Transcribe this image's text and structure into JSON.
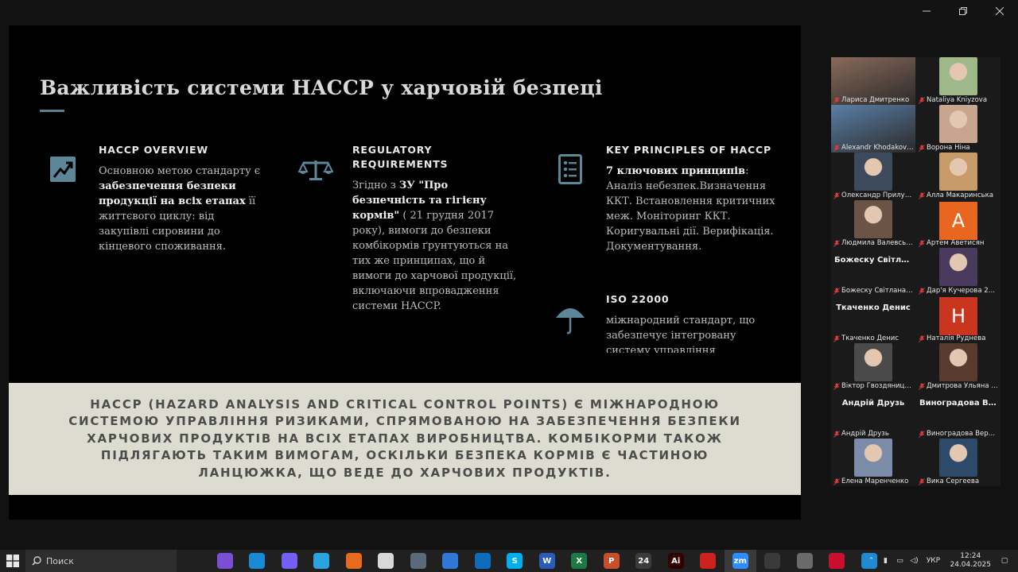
{
  "window": {
    "minimize_label": "",
    "maximize_label": "",
    "close_label": ""
  },
  "slide": {
    "title": "Важливість системи HACCP у харчовій безпеці",
    "columns": [
      {
        "heading": "HACCP OVERVIEW",
        "text_parts": [
          {
            "t": "Основною метою стандарту є ",
            "b": false
          },
          {
            "t": "забезпечення безпеки продукції на всіх етапах",
            "b": true
          },
          {
            "t": " її життєвого циклу: від закупівлі сировини до кінцевого споживання.",
            "b": false
          }
        ]
      },
      {
        "heading": "REGULATORY REQUIREMENTS",
        "text_parts": [
          {
            "t": "Згідно з ",
            "b": false
          },
          {
            "t": "ЗУ \"Про безпечність та гігієну кормів\"",
            "b": true
          },
          {
            "t": " ( 21 грудня 2017 року), вимоги до безпеки комбікормів ґрунтуються на тих же принципах, що й вимоги до харчової продукції, включаючи впровадження системи HACCP.",
            "b": false
          }
        ]
      },
      {
        "heading": "KEY PRINCIPLES OF HACCP",
        "text_parts": [
          {
            "t": "7 ключових принципів",
            "b": true
          },
          {
            "t": ": Аналіз небезпек.Визначення ККТ. Встановлення критичних меж. Моніторинг ККТ. Коригувальні дії. Верифікація. Документування.",
            "b": false
          }
        ]
      },
      {
        "heading": "ISO 22000",
        "text_parts": [
          {
            "t": "міжнародний стандарт, що забезпечує інтегровану систему управління",
            "b": false
          }
        ]
      }
    ],
    "banner": "HACCP (HAZARD ANALYSIS AND CRITICAL CONTROL POINTS) Є МІЖНАРОДНОЮ СИСТЕМОЮ УПРАВЛІННЯ РИЗИКАМИ, СПРЯМОВАНОЮ НА ЗАБЕЗПЕЧЕННЯ БЕЗПЕКИ ХАРЧОВИХ ПРОДУКТІВ НА ВСІХ ЕТАПАХ ВИРОБНИЦТВА. КОМБІКОРМИ ТАКОЖ ПІДЛЯГАЮТЬ ТАКИМ ВИМОГАМ, ОСКІЛЬКИ БЕЗПЕКА КОРМІВ Є ЧАСТИНОЮ ЛАНЦЮЖКА, ЩО ВЕДЕ ДО ХАРЧОВИХ ПРОДУКТІВ."
  },
  "participants": [
    {
      "name": "Лариса Дмитренко",
      "kind": "video",
      "color": "#8a6a5a"
    },
    {
      "name": "Nataliya Kniyzova",
      "kind": "photo",
      "color": "#9fb889"
    },
    {
      "name": "Alexandr Khodakovskiy",
      "kind": "video",
      "color": "#5a7fa8",
      "active": true
    },
    {
      "name": "Ворона Ніна",
      "kind": "photo",
      "color": "#c8a58f"
    },
    {
      "name": "Олександр Прилуцьк...",
      "kind": "photo",
      "color": "#3c4a5c"
    },
    {
      "name": "Алла Макаринська",
      "kind": "photo",
      "color": "#c79a6a"
    },
    {
      "name": "Людмила Валевська",
      "kind": "photo",
      "color": "#6b5446"
    },
    {
      "name": "Артем Аветисян",
      "kind": "initial",
      "initial": "A",
      "color": "#e8661f"
    },
    {
      "name": "Божеску Світлана 2Т3",
      "display": "Божеску Світла...",
      "kind": "name"
    },
    {
      "name": "Дар'я Кучерова 2Тв-...",
      "kind": "photo",
      "color": "#4a3a5e"
    },
    {
      "name": "Ткаченко Денис",
      "display": "Ткаченко Денис",
      "kind": "name"
    },
    {
      "name": "Наталія Руднева",
      "kind": "initial",
      "initial": "Н",
      "color": "#c9351f"
    },
    {
      "name": "Віктор Гвоздяницз 2Тз",
      "kind": "photo",
      "color": "#4a4a4a"
    },
    {
      "name": "Дмитрова Ульяна 2Т...",
      "kind": "photo",
      "color": "#5a3a2e"
    },
    {
      "name": "Андрій Друзь",
      "display": "Андрій Друзь",
      "kind": "name"
    },
    {
      "name": "Виноградова Вероні...",
      "display": "Виноградова В...",
      "kind": "name"
    },
    {
      "name": "Елена Маренченко",
      "kind": "photo",
      "color": "#7b8ca8"
    },
    {
      "name": "Вика Сергеева",
      "kind": "photo",
      "color": "#2e4a6a"
    }
  ],
  "taskbar": {
    "search_placeholder": "Поиск",
    "apps": [
      {
        "name": "task-view",
        "label": "",
        "color": "#202020"
      },
      {
        "name": "copilot",
        "label": "",
        "color": "#7a4fd6"
      },
      {
        "name": "edge",
        "label": "",
        "color": "#1a8ad4"
      },
      {
        "name": "viber",
        "label": "",
        "color": "#7360f2"
      },
      {
        "name": "telegram",
        "label": "",
        "color": "#2aa3df"
      },
      {
        "name": "firefox",
        "label": "",
        "color": "#e66b1f"
      },
      {
        "name": "file",
        "label": "",
        "color": "#d8d8d8"
      },
      {
        "name": "calculator",
        "label": "",
        "color": "#5b6a7a"
      },
      {
        "name": "calendar",
        "label": "",
        "color": "#2f78d6"
      },
      {
        "name": "outlook",
        "label": "",
        "color": "#0f6cbd"
      },
      {
        "name": "skype",
        "label": "S",
        "color": "#00aff0"
      },
      {
        "name": "word",
        "label": "W",
        "color": "#2b5cb8"
      },
      {
        "name": "excel",
        "label": "X",
        "color": "#1e7a45"
      },
      {
        "name": "powerpoint",
        "label": "P",
        "color": "#c94f2a"
      },
      {
        "name": "calendar2",
        "label": "24",
        "color": "#3b3b3b"
      },
      {
        "name": "illustrator",
        "label": "Ai",
        "color": "#330000"
      },
      {
        "name": "acrobat",
        "label": "",
        "color": "#c9221f"
      },
      {
        "name": "zoom",
        "label": "zm",
        "color": "#2d8cff",
        "active": true
      },
      {
        "name": "scanner",
        "label": "",
        "color": "#3a3a3a"
      },
      {
        "name": "paint",
        "label": "",
        "color": "#6a6a6a"
      },
      {
        "name": "sync-app",
        "label": "",
        "color": "#c8102e"
      },
      {
        "name": "vscode",
        "label": "",
        "color": "#1f8ad2"
      }
    ],
    "lang": "УКР",
    "time": "12:24",
    "date": "24.04.2025"
  }
}
